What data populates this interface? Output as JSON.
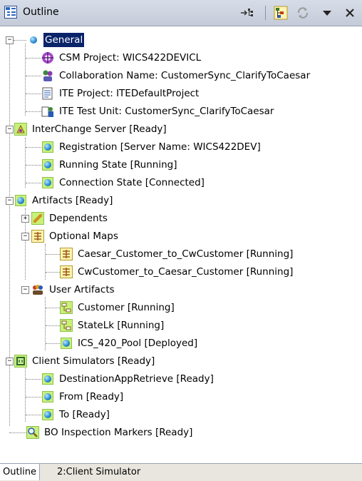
{
  "view": {
    "title": "Outline",
    "toolbar": {
      "link_icon": "link-with-editor-icon",
      "tree_icon": "tree-view-icon",
      "sync_icon": "sync-icon",
      "menu_icon": "view-menu-icon",
      "close_icon": "close-icon"
    }
  },
  "tree": [
    {
      "label": "General",
      "icon": "blue-ball-icon",
      "selected": true
    },
    {
      "label": "CSM Project: WICS422DEVICL",
      "icon": "csm-project-icon"
    },
    {
      "label": "Collaboration Name: CustomerSync_ClarifyToCaesar",
      "icon": "collaboration-icon"
    },
    {
      "label": "ITE Project: ITEDefaultProject",
      "icon": "document-icon"
    },
    {
      "label": "ITE Test Unit: CustomerSync_ClarifyToCaesar",
      "icon": "test-unit-icon"
    },
    {
      "label": "InterChange Server [Ready]",
      "icon": "server-icon"
    },
    {
      "label": "Registration [Server Name: WICS422DEV]",
      "icon": "status-ball-icon"
    },
    {
      "label": "Running State [Running]",
      "icon": "status-ball-icon"
    },
    {
      "label": "Connection State [Connected]",
      "icon": "status-ball-icon"
    },
    {
      "label": "Artifacts [Ready]",
      "icon": "status-ball-icon"
    },
    {
      "label": "Dependents",
      "icon": "dependents-icon"
    },
    {
      "label": "Optional Maps",
      "icon": "map-icon"
    },
    {
      "label": "Caesar_Customer_to_CwCustomer [Running]",
      "icon": "map-icon"
    },
    {
      "label": "CwCustomer_to_Caesar_Customer [Running]",
      "icon": "map-icon"
    },
    {
      "label": "User Artifacts",
      "icon": "user-artifacts-icon"
    },
    {
      "label": "Customer [Running]",
      "icon": "relationship-icon"
    },
    {
      "label": "StateLk [Running]",
      "icon": "relationship-icon"
    },
    {
      "label": "ICS_420_Pool [Deployed]",
      "icon": "status-ball-icon"
    },
    {
      "label": "Client Simulators [Ready]",
      "icon": "client-simulator-icon"
    },
    {
      "label": "DestinationAppRetrieve [Ready]",
      "icon": "status-ball-icon"
    },
    {
      "label": "From [Ready]",
      "icon": "status-ball-icon"
    },
    {
      "label": "To [Ready]",
      "icon": "status-ball-icon"
    },
    {
      "label": "BO Inspection Markers [Ready]",
      "icon": "inspection-markers-icon"
    }
  ],
  "tabs": [
    {
      "label": "Outline",
      "active": true
    },
    {
      "label": "2:Client Simulator",
      "active": false
    }
  ]
}
